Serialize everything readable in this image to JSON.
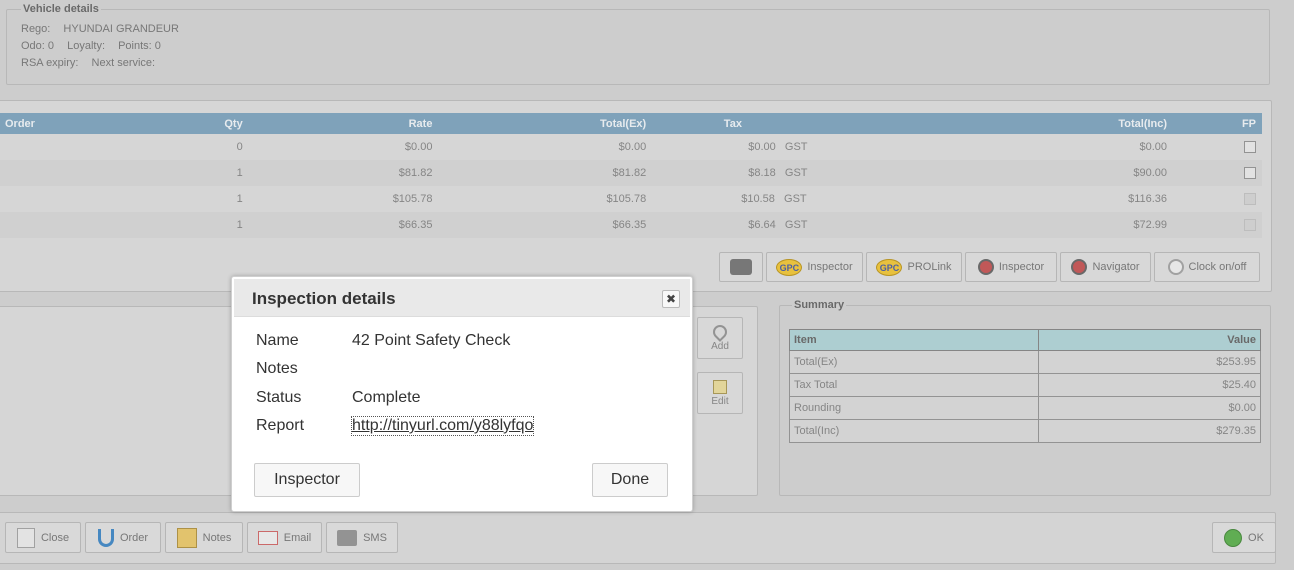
{
  "vehicle": {
    "legend": "Vehicle details",
    "rego_label": "Rego:",
    "rego_value": "HYUNDAI GRANDEUR",
    "odo": "Odo: 0",
    "loyalty": "Loyalty:",
    "points": "Points: 0",
    "rsa": "RSA expiry:",
    "next_service": "Next service:"
  },
  "lines": {
    "headers": [
      "Order",
      "Qty",
      "Rate",
      "Total(Ex)",
      "Tax",
      "Total(Inc)",
      "FP"
    ],
    "rows": [
      {
        "qty": "0",
        "rate": "$0.00",
        "total_ex": "$0.00",
        "tax": "$0.00",
        "tax_type": "GST",
        "total_inc": "$0.00",
        "fp_enabled": true
      },
      {
        "qty": "1",
        "rate": "$81.82",
        "total_ex": "$81.82",
        "tax": "$8.18",
        "tax_type": "GST",
        "total_inc": "$90.00",
        "fp_enabled": true
      },
      {
        "qty": "1",
        "rate": "$105.78",
        "total_ex": "$105.78",
        "tax": "$10.58",
        "tax_type": "GST",
        "total_inc": "$116.36",
        "fp_enabled": false
      },
      {
        "qty": "1",
        "rate": "$66.35",
        "total_ex": "$66.35",
        "tax": "$6.64",
        "tax_type": "GST",
        "total_inc": "$72.99",
        "fp_enabled": false
      }
    ]
  },
  "toolbar": {
    "gpc_badge": "GPC",
    "gpc_inspector": "Inspector",
    "gpc_prolink": "PROLink",
    "inspector": "Inspector",
    "navigator": "Navigator",
    "clock": "Clock on/off"
  },
  "side_buttons": {
    "add": "Add",
    "edit": "Edit"
  },
  "summary": {
    "legend": "Summary",
    "headers": [
      "Item",
      "Value"
    ],
    "rows": [
      {
        "item": "Total(Ex)",
        "value": "$253.95"
      },
      {
        "item": "Tax Total",
        "value": "$25.40"
      },
      {
        "item": "Rounding",
        "value": "$0.00"
      },
      {
        "item": "Total(Inc)",
        "value": "$279.35"
      }
    ]
  },
  "footer": {
    "close": "Close",
    "order": "Order",
    "notes": "Notes",
    "email": "Email",
    "sms": "SMS",
    "ok": "OK"
  },
  "modal": {
    "title": "Inspection details",
    "close_glyph": "✖",
    "name_label": "Name",
    "name_value": "42 Point Safety Check",
    "notes_label": "Notes",
    "notes_value": "",
    "status_label": "Status",
    "status_value": "Complete",
    "report_label": "Report",
    "report_value": "http://tinyurl.com/y88lyfqo",
    "inspector_button": "Inspector",
    "done_button": "Done"
  }
}
